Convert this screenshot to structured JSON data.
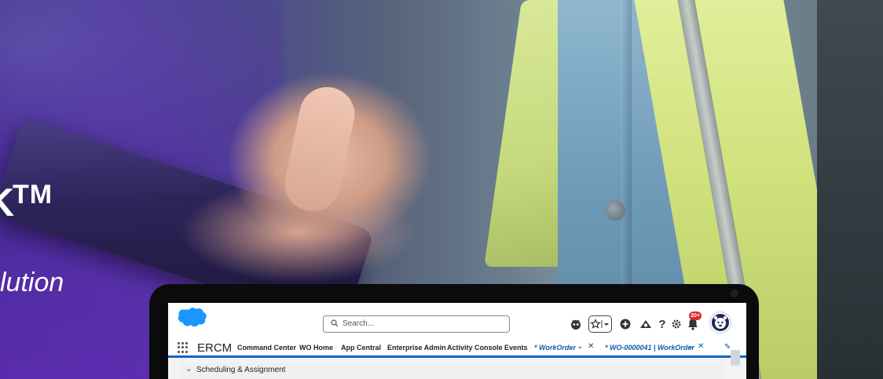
{
  "hero": {
    "trademark": "TM",
    "tagline": "lution"
  },
  "app": {
    "search_placeholder": "Search...",
    "app_name": "ERCM",
    "nav_items": [
      "Command Center",
      "WO Home",
      "App Central",
      "Enterprise Admin",
      "Activity Console",
      "Events"
    ],
    "tabs": [
      {
        "label": "* WorkOrder"
      },
      {
        "label": "* WO-0000041 | WorkOrder"
      }
    ],
    "notification_badge": "20+",
    "section_label": "Scheduling & Assignment"
  },
  "colors": {
    "brand_blue": "#0b66c4",
    "salesforce_cloud": "#1b96ff",
    "badge_red": "#d92b2b"
  },
  "icons": [
    "salesforce-logo-icon",
    "search-icon",
    "astro-icon",
    "favorites-icon",
    "add-icon",
    "trailhead-icon",
    "help-icon",
    "gear-icon",
    "notification-bell-icon",
    "avatar-icon",
    "app-launcher-icon",
    "chevron-down-icon",
    "close-icon",
    "pencil-icon"
  ]
}
